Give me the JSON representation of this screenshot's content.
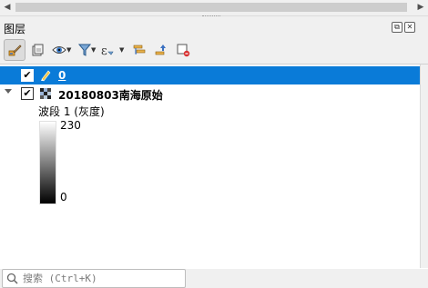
{
  "panel": {
    "title": "图层"
  },
  "header_buttons": {
    "float_glyph": "⧉",
    "close_glyph": "✕"
  },
  "toolbar": {
    "buttons": [
      {
        "name": "layer-styling-icon"
      },
      {
        "name": "add-group-icon"
      },
      {
        "name": "manage-visibility-icon"
      },
      {
        "name": "filter-legend-icon"
      },
      {
        "name": "filter-expression-icon"
      },
      {
        "name": "expand-all-icon"
      },
      {
        "name": "collapse-all-icon"
      },
      {
        "name": "remove-layer-icon"
      }
    ]
  },
  "layers": [
    {
      "name": "0",
      "checked": true,
      "selected": true,
      "icon": "pencil-icon"
    },
    {
      "name": "20180803南海原始",
      "checked": true,
      "selected": false,
      "expanded": true,
      "icon": "raster-layer-icon"
    }
  ],
  "legend": {
    "band_label": "波段 1 (灰度)",
    "max": "230",
    "min": "0"
  },
  "search": {
    "placeholder": "搜索 (Ctrl+K)"
  },
  "colors": {
    "selection": "#0a7bd8",
    "panel_bg": "#f0f0f0",
    "tree_bg": "#ffffff"
  }
}
